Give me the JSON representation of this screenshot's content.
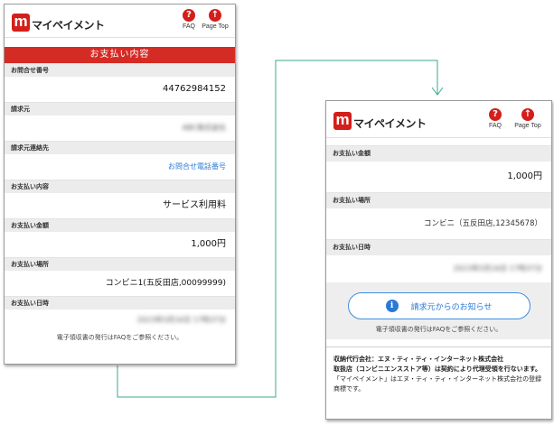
{
  "app": {
    "logo_glyph": "m",
    "logo_text": "マイペイメント"
  },
  "header": {
    "faq_label": "FAQ",
    "page_top_label": "Page Top",
    "faq_icon": "question-circle-icon",
    "page_top_icon": "arrow-up-circle-icon"
  },
  "colors": {
    "brand_red": "#d51e1a",
    "link_blue": "#2a79d6",
    "connector": "#3aaa8e"
  },
  "left": {
    "title": "お支払い内容",
    "sections": [
      {
        "label": "お問合せ番号",
        "value": "44762984152"
      },
      {
        "label": "請求元",
        "value": "ABC株式会社"
      },
      {
        "label": "請求元連絡先",
        "value": "お問合せ電話番号"
      },
      {
        "label": "お支払い内容",
        "value": "サービス利用料"
      },
      {
        "label": "お支払い金額",
        "value": "1,000円"
      },
      {
        "label": "お支払い場所",
        "value": "コンビニ1(五反田店,00099999)"
      },
      {
        "label": "お支払い日時",
        "value": "2023年5月16日 17時37分"
      }
    ],
    "footer": "電子領収書の発行はFAQをご参照ください。"
  },
  "right": {
    "sections": [
      {
        "label": "お支払い金額",
        "value": "1,000円"
      },
      {
        "label": "お支払い場所",
        "value": "コンビニ（五反田店,12345678）"
      },
      {
        "label": "お支払い日時",
        "value": "2023年5月16日 17時37分"
      }
    ],
    "notice_button": "請求元からのお知らせ",
    "footer": "電子領収書の発行はFAQをご参照ください。",
    "company": {
      "line1": "収納代行会社：エヌ・ティ・ティ・インターネット株式会社",
      "line2": "取扱店（コンビニエンスストア等）は契約により代理受領を行ないます。",
      "line3": "「マイペイメント」はエヌ・ティ・ティ・インターネット株式会社の登録商標です。"
    }
  }
}
